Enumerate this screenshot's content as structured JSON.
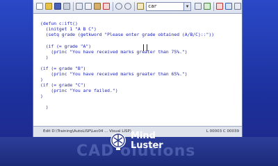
{
  "toolbar": {
    "search_value": "car"
  },
  "editor": {
    "lines": [
      "(defun c:ift()",
      "  (initget 1 \"A B C\")",
      "  (setq grade (getkword \"Please enter grade obtained (A/B/C)::\"))",
      "",
      "  (if (= grade \"A\")",
      "    (princ \"You have received marks greater than 75%.\")",
      "  )",
      "",
      "(if (= grade \"B\")",
      "    (princ \"You have received marks greater than 65%.\")",
      ")",
      "(if (= grade \"C\")",
      "    (princ \"You are failed.\")",
      ")",
      "",
      "  )"
    ]
  },
  "status": {
    "path": "Edit  D:\\Training\\AutoLISP\\Lec04 ... Visual LISP)",
    "position": "L 00003  C 00039"
  },
  "watermark": {
    "banner_text": "CAD      olutions",
    "brand_line1": "Mind",
    "brand_line2": "Luster"
  }
}
